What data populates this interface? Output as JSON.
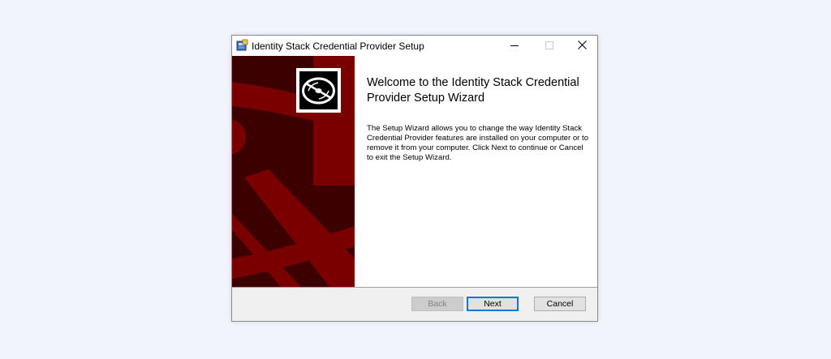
{
  "window": {
    "title": "Identity Stack Credential Provider Setup"
  },
  "wizard": {
    "heading": "Welcome to the Identity Stack Credential Provider Setup Wizard",
    "description": "The Setup Wizard allows you to change the way Identity Stack Credential Provider features are installed on your computer or to remove it from your computer. Click Next to continue or Cancel to exit the Setup Wizard."
  },
  "buttons": {
    "back": "Back",
    "next": "Next",
    "cancel": "Cancel"
  },
  "icons": {
    "app": "installer-icon",
    "banner": "disc-icon",
    "minimize": "minimize-icon",
    "maximize": "maximize-icon",
    "close": "close-icon"
  },
  "colors": {
    "banner_dark": "#3c0000",
    "banner_red": "#7a0000",
    "accent": "#0078d7"
  }
}
